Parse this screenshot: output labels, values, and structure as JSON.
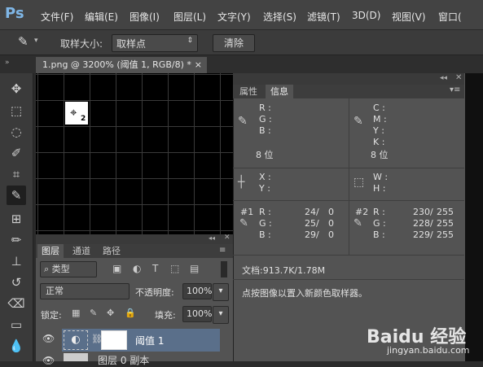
{
  "app": {
    "logo": "Ps"
  },
  "menu": [
    "文件(F)",
    "编辑(E)",
    "图像(I)",
    "图层(L)",
    "文字(Y)",
    "选择(S)",
    "滤镜(T)",
    "3D(D)",
    "视图(V)",
    "窗口("
  ],
  "options": {
    "sample_size_label": "取样大小:",
    "sample_size_value": "取样点",
    "clear_button": "清除"
  },
  "document_tab": {
    "title": "1.png @ 3200% (阈值 1, RGB/8) *",
    "close": "×"
  },
  "info_panel": {
    "tabs": [
      "属性",
      "信息"
    ],
    "active_tab": "信息",
    "rgb": {
      "r": "R :",
      "g": "G :",
      "b": "B :",
      "bits": "8 位"
    },
    "cmyk": {
      "c": "C :",
      "m": "M :",
      "y": "Y :",
      "k": "K :",
      "bits": "8 位"
    },
    "xy": {
      "x": "X :",
      "y": "Y :"
    },
    "wh": {
      "w": "W :",
      "h": "H :"
    },
    "sampler1": {
      "label": "#1",
      "r": "R :",
      "g": "G :",
      "b": "B :",
      "r_val": "24/",
      "g_val": "25/",
      "b_val": "29/",
      "r_new": "0",
      "g_new": "0",
      "b_new": "0"
    },
    "sampler2": {
      "label": "#2",
      "r": "R :",
      "g": "G :",
      "b": "B :",
      "r_val": "230/",
      "g_val": "228/",
      "b_val": "229/",
      "r_new": "255",
      "g_new": "255",
      "b_new": "255"
    },
    "doc_size": "文档:913.7K/1.78M",
    "hint": "点按图像以置入新颜色取样器。"
  },
  "layers_panel": {
    "tabs": [
      "图层",
      "通道",
      "路径"
    ],
    "filter_kind": "类型",
    "blend_mode": "正常",
    "opacity_label": "不透明度:",
    "opacity_value": "100%",
    "lock_label": "锁定:",
    "fill_label": "填充:",
    "fill_value": "100%",
    "layers": [
      {
        "name": "阈值 1"
      },
      {
        "name": "图层 0 副本"
      }
    ]
  },
  "canvas": {
    "sampler_marker": "2"
  },
  "watermark": {
    "brand": "Baidu 经验",
    "url": "jingyan.baidu.com"
  }
}
